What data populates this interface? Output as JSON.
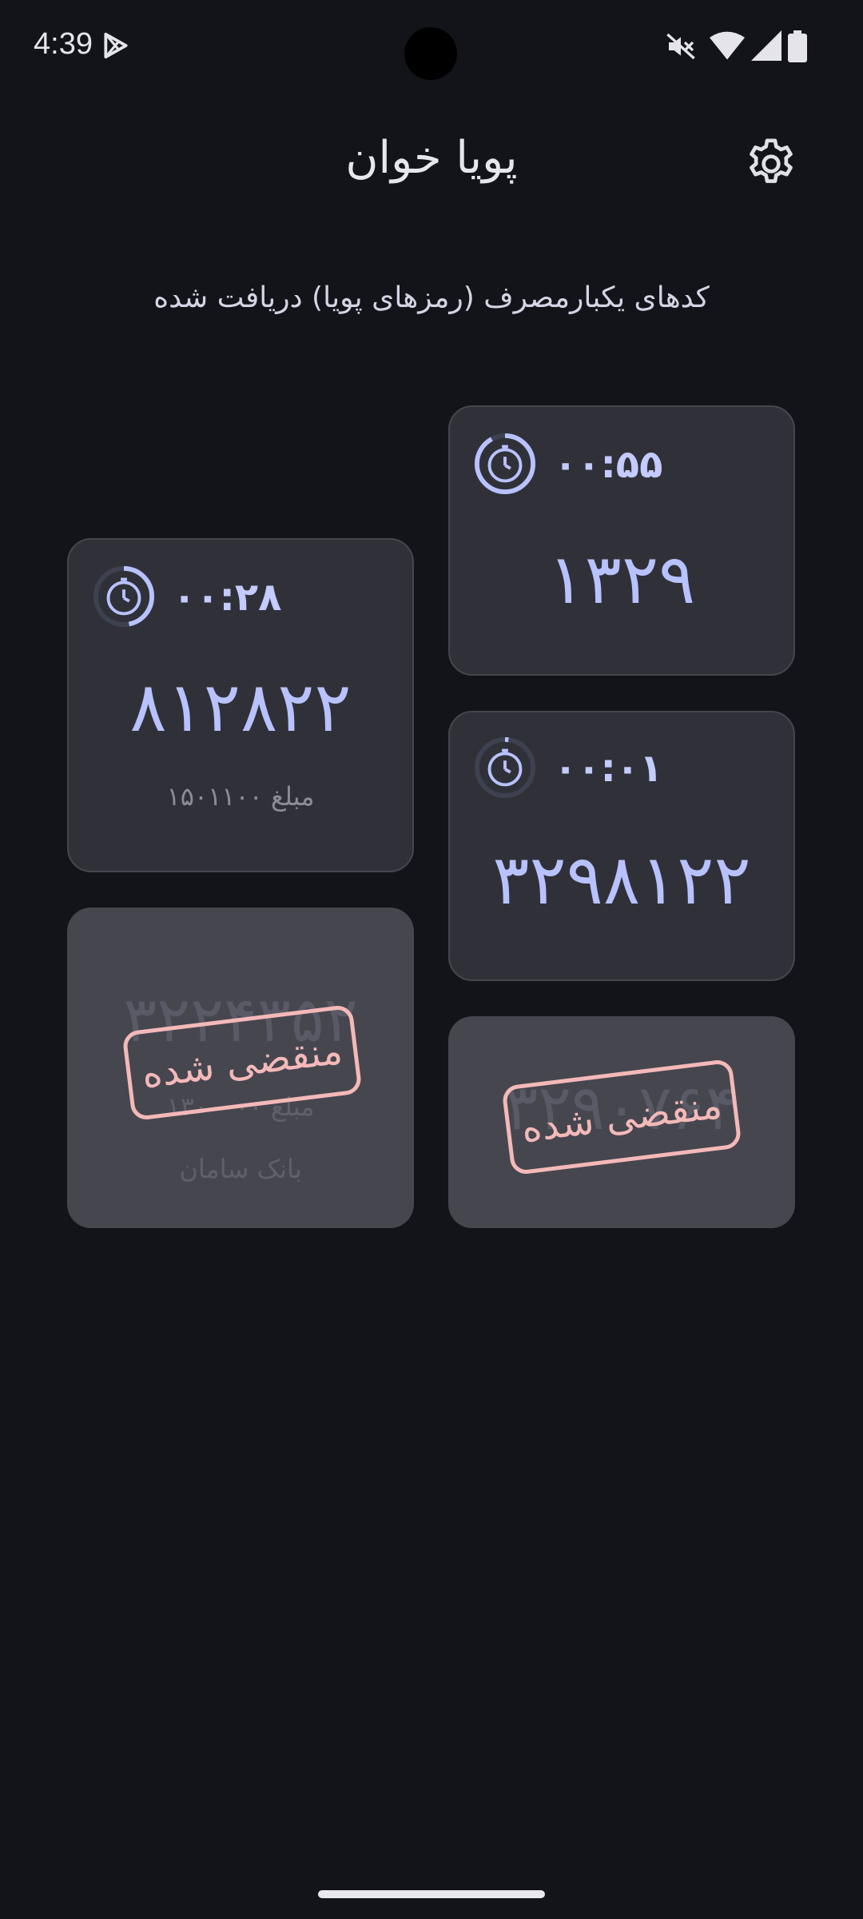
{
  "status_bar": {
    "time": "4:39",
    "icons": [
      "play-store-icon",
      "mute-icon",
      "wifi-icon",
      "signal-icon",
      "battery-icon"
    ]
  },
  "app_bar": {
    "title": "پویا خوان",
    "settings_icon": "gear-icon"
  },
  "subtitle": "کدهای یکبارمصرف (رمزهای پویا) دریافت شده",
  "cards": [
    {
      "timer": "۰۰:۵۵",
      "code": "۱۳۲۹",
      "progress": 0.92,
      "expired": false
    },
    {
      "timer": "۰۰:۲۸",
      "code": "۸۱۲۸۲۲",
      "amount": "مبلغ ۱۵۰۱۱۰۰",
      "progress": 0.47,
      "expired": false
    },
    {
      "timer": "۰۰:۰۱",
      "code": "۳۲۹۸۱۲۲",
      "progress": 0.02,
      "expired": false
    },
    {
      "code": "۳۲۲۴۳۵۲",
      "amount": "مبلغ ۱۳۰۰۰۰۰",
      "bank": "بانک سامان",
      "expired": true,
      "stamp": "منقضی شده"
    },
    {
      "code": "۳۲۹۰۷۶۴",
      "expired": true,
      "stamp": "منقضی شده"
    }
  ],
  "colors": {
    "background": "#131419",
    "card": "#303138",
    "expired_card": "#46464f",
    "accent": "#b8c2ff",
    "stamp": "#f3b9b8"
  }
}
